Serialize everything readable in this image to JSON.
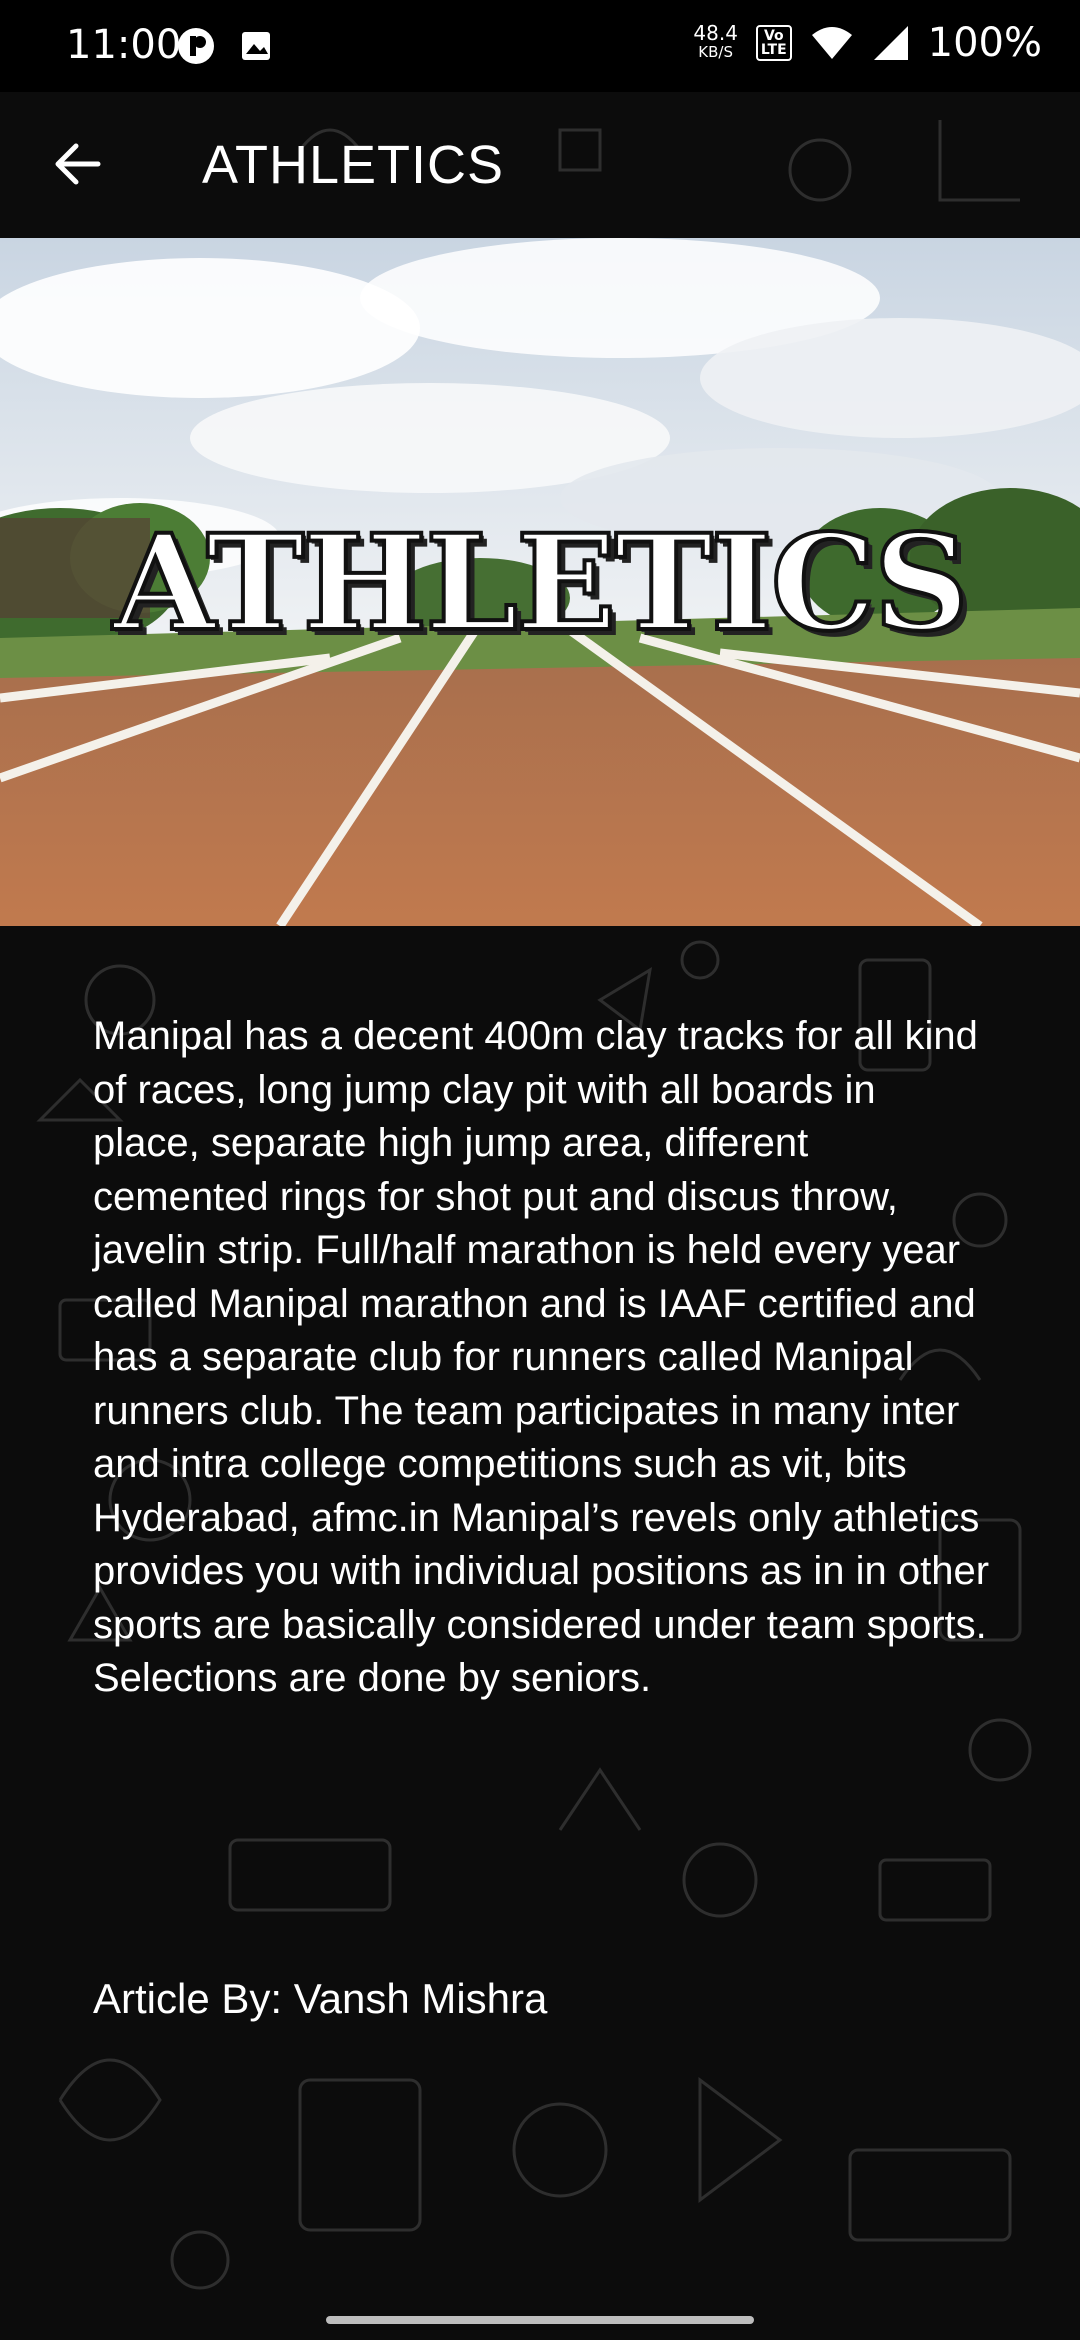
{
  "status_bar": {
    "time": "11:00",
    "speed_value": "48.4",
    "speed_unit": "KB/S",
    "volte": "Vo\nLTE",
    "battery": "100%"
  },
  "app_bar": {
    "title": "ATHLETICS"
  },
  "hero": {
    "title": "ATHLETICS"
  },
  "article": {
    "body": "Manipal has a decent 400m clay tracks for all kind of races, long jump clay pit with all boards in place, separate high jump area, different cemented rings for shot put and discus throw, javelin strip. Full/half marathon is held every year called Manipal marathon and is IAAF certified and has a separate club for runners called Manipal runners club. The team participates in many inter and intra college competitions such as vit, bits Hyderabad, afmc.in Manipal’s revels only athletics provides you with individual positions as in in other sports are basically considered under team sports. Selections are done by seniors.",
    "author": "Article By: Vansh Mishra"
  },
  "colors": {
    "background": "#0c0c0c",
    "text": "#ffffff",
    "track": "#b7744c",
    "grass": "#5e8a3a",
    "sky": "#dfe7ef"
  }
}
